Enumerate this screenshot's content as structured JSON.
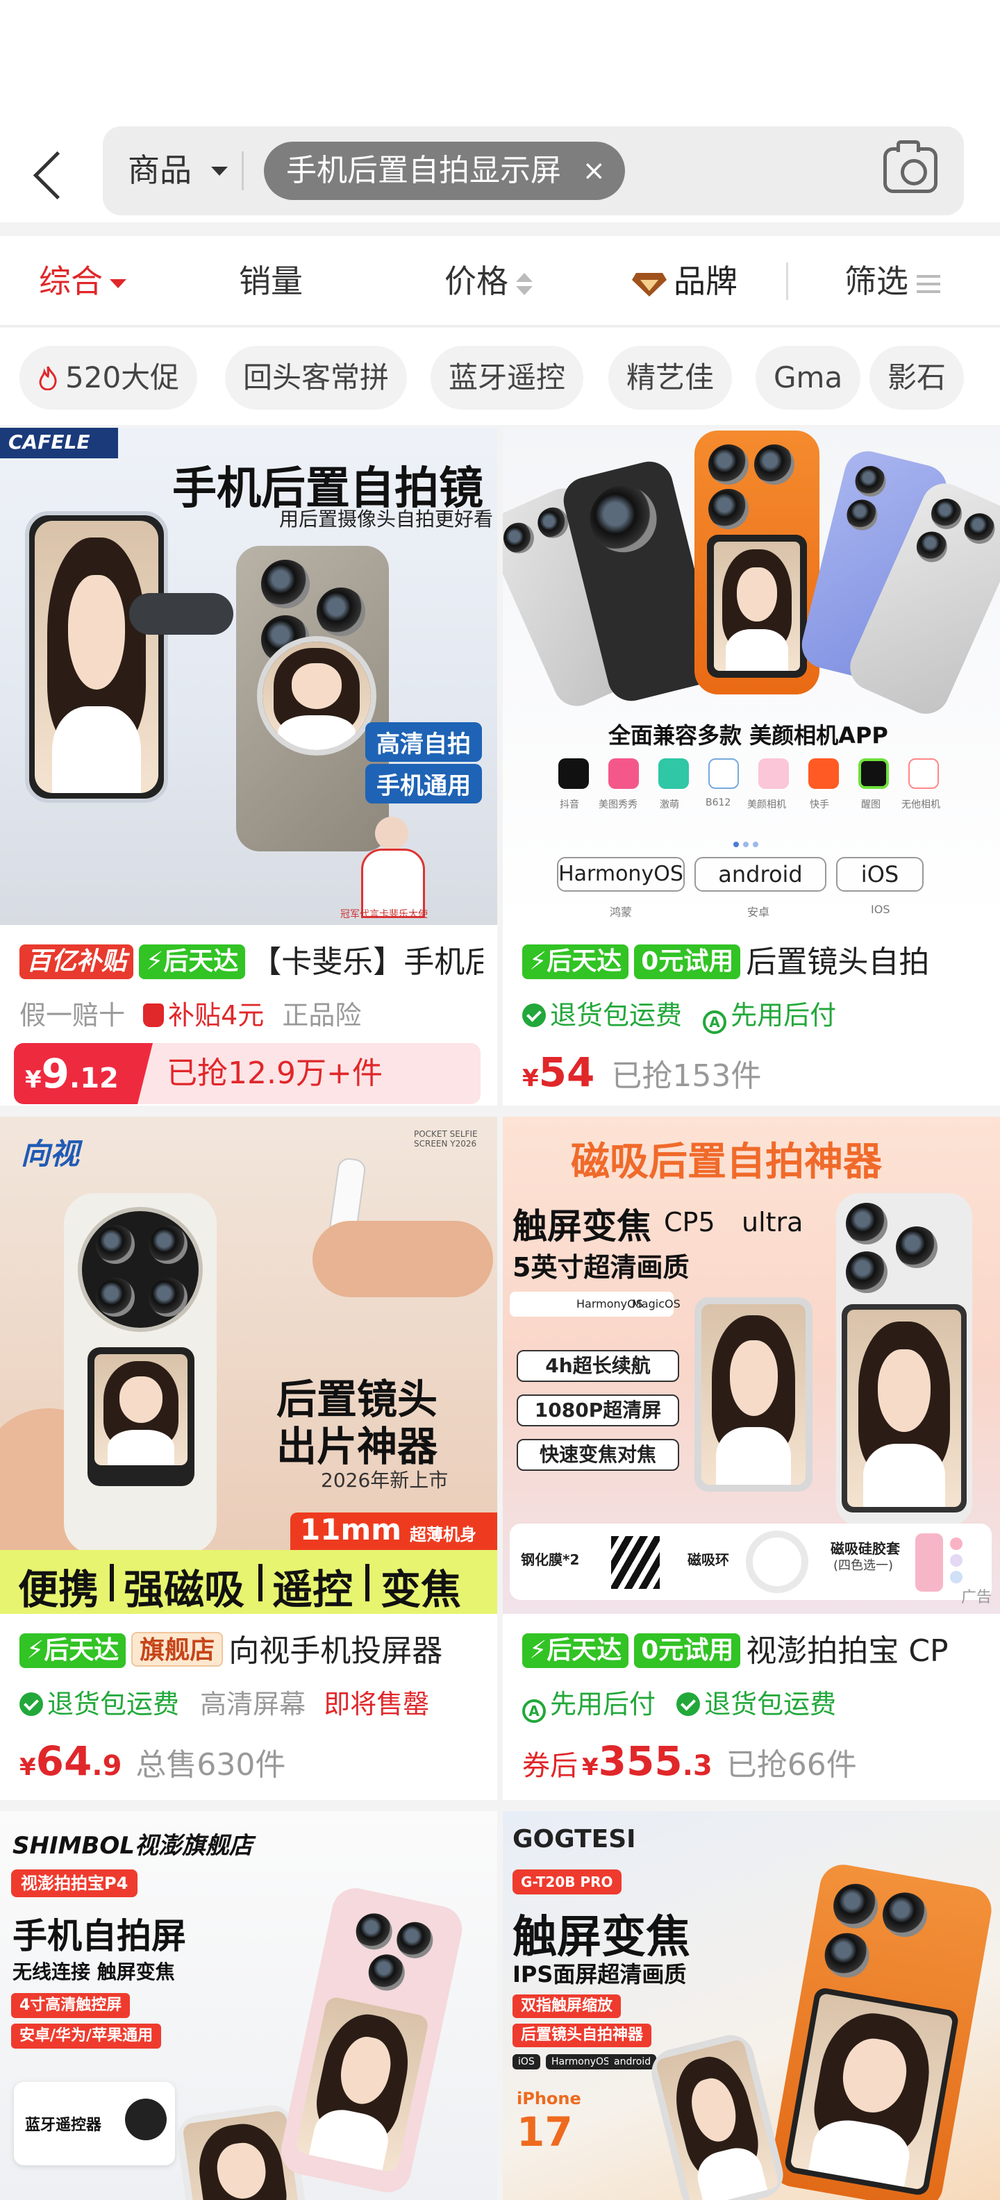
{
  "search": {
    "scope": "商品",
    "query": "手机后置自拍显示屏",
    "clear_symbol": "×"
  },
  "sort": {
    "comprehensive": "综合",
    "sales": "销量",
    "price": "价格",
    "brand": "品牌",
    "filter": "筛选"
  },
  "quick_filters": [
    "520大促",
    "回头客常拼",
    "蓝牙遥控",
    "精艺佳",
    "Gma",
    "影石"
  ],
  "colors": {
    "accent_red": "#e0272a",
    "green": "#22a83a",
    "tag_green": "#32c325"
  },
  "products": [
    {
      "tags": [
        "百亿补贴",
        "⚡后天达"
      ],
      "title": "【卡斐乐】手机后置自拍镜",
      "guarantee": "假一赔十",
      "subsidy": "补贴4元",
      "insurance": "正品险",
      "price_int": "9",
      "price_dec": ".12",
      "sold": "已抢12.9万+件",
      "image": {
        "brand": "CAFELE",
        "headline": "手机后置自拍镜",
        "subline": "用后置摄像头自拍更好看",
        "badge1": "高清自拍",
        "badge2": "手机通用",
        "caption": "冠军代言卡斐乐大使"
      }
    },
    {
      "tags": [
        "⚡后天达",
        "0元试用"
      ],
      "title": "后置镜头自拍",
      "benefit1": "退货包运费",
      "benefit2": "先用后付",
      "price_int": "54",
      "sold": "已抢153件",
      "image": {
        "headline": "全面兼容多款 美颜相机APP",
        "apps": [
          "抖音",
          "美图秀秀",
          "激萌",
          "B612",
          "美颜相机",
          "快手",
          "醒图",
          "无他相机"
        ],
        "systems": [
          "HarmonyOS",
          "android",
          "iOS"
        ],
        "system_labels": [
          "鸿蒙",
          "安卓",
          "IOS"
        ]
      }
    },
    {
      "tags": [
        "⚡后天达",
        "旗舰店"
      ],
      "title": "向视手机投屏器",
      "benefit1": "退货包运费",
      "feature": "高清屏幕",
      "urgency": "即将售罄",
      "price_int": "64",
      "price_dec": ".9",
      "sold": "总售630件",
      "image": {
        "brand": "向视",
        "corner": "POCKET SELFIE SCREEN Y2026",
        "headline1": "后置镜头",
        "headline2": "出片神器",
        "year": "2026年新上市",
        "thin": "11mm",
        "thin_label": "超薄机身",
        "features": [
          "便携",
          "强磁吸",
          "遥控",
          "变焦"
        ]
      }
    },
    {
      "tags": [
        "⚡后天达",
        "0元试用"
      ],
      "title": "视澎拍拍宝 CP",
      "benefit1": "先用后付",
      "benefit2": "退货包运费",
      "price_prefix": "券后",
      "price_int": "355",
      "price_dec": ".3",
      "sold": "已抢66件",
      "ad": "广告",
      "image": {
        "banner": "磁吸后置自拍神器",
        "line1": "触屏变焦",
        "model": "CP5",
        "ultra": "ultra",
        "line2": "5英寸超清画质",
        "os": [
          "HarmonyOS",
          "MagicOS"
        ],
        "features": [
          "4h超长续航",
          "1080P超清屏",
          "快速变焦对焦"
        ],
        "accessories": [
          "钢化膜*2",
          "磁吸环",
          "磁吸硅胶套",
          "(四色选一)"
        ]
      }
    },
    {
      "image": {
        "brand": "SHIMBOL视澎旗舰店",
        "model_tag": "视澎拍拍宝P4",
        "headline": "手机自拍屏",
        "subline": "无线连接 触屏变焦",
        "badge1": "4寸高清触控屏",
        "badge2": "安卓/华为/苹果通用",
        "remote": "蓝牙遥控器"
      }
    },
    {
      "image": {
        "brand": "GOGTESI",
        "model": "G-T20B PRO",
        "headline": "触屏变焦",
        "subline": "IPS面屏超清画质",
        "badge1": "双指触屏缩放",
        "badge2": "后置镜头自拍神器",
        "systems": [
          "iOS",
          "HarmonyOS",
          "android"
        ],
        "iphone_label": "iPhone",
        "iphone_num": "17"
      }
    }
  ]
}
